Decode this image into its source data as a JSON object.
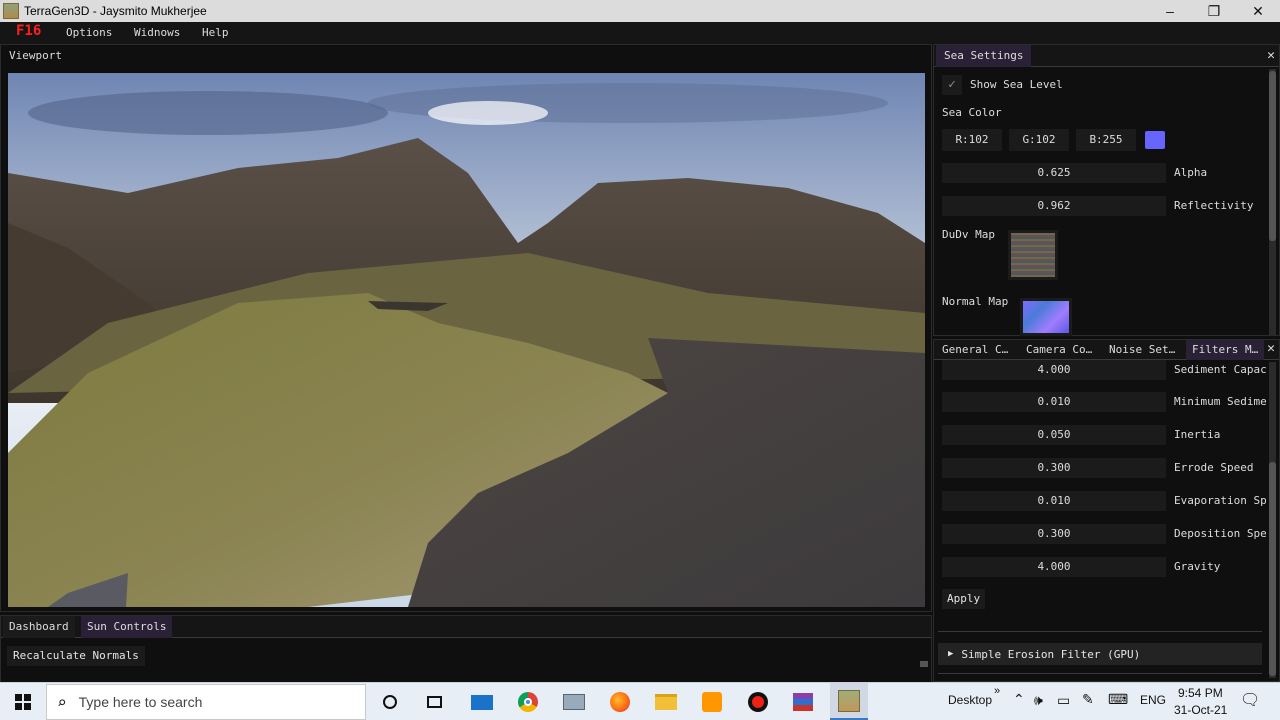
{
  "window": {
    "title": "TerraGen3D - Jaysmito Mukherjee",
    "minimize": "–",
    "restore": "❐",
    "close": "✕"
  },
  "menubar": {
    "fps": "F16",
    "items": [
      "Options",
      "Widnows",
      "Help"
    ]
  },
  "viewport": {
    "tab": "Viewport"
  },
  "sea_settings": {
    "tab": "Sea Settings",
    "show_sea_level_label": "Show Sea Level",
    "show_sea_level_checked": true,
    "sea_color_label": "Sea Color",
    "r": "R:102",
    "g": "G:102",
    "b": "B:255",
    "swatch_color": "#6666ff",
    "alpha_value": "0.625",
    "alpha_label": "Alpha",
    "reflectivity_value": "0.962",
    "reflectivity_label": "Reflectivity",
    "dudv_label": "DuDv Map",
    "normal_label": "Normal Map"
  },
  "filters": {
    "tabs": [
      "General C…",
      "Camera Co…",
      "Noise Set…",
      "Filters M…"
    ],
    "rows": [
      {
        "value": "4.000",
        "label": "Sediment Capac"
      },
      {
        "value": "0.010",
        "label": "Minimum Sedime"
      },
      {
        "value": "0.050",
        "label": "Inertia"
      },
      {
        "value": "0.300",
        "label": "Errode Speed"
      },
      {
        "value": "0.010",
        "label": "Evaporation Sp"
      },
      {
        "value": "0.300",
        "label": "Deposition Spe"
      },
      {
        "value": "4.000",
        "label": "Gravity"
      }
    ],
    "apply": "Apply",
    "collapse_label": "Simple Erosion Filter (GPU)"
  },
  "bottom": {
    "tabs": [
      "Dashboard",
      "Sun Controls"
    ],
    "recalc": "Recalculate Normals"
  },
  "taskbar": {
    "search_placeholder": "Type here to search",
    "desktop": "Desktop",
    "lang": "ENG",
    "time": "9:54 PM",
    "date": "31-Oct-21"
  }
}
